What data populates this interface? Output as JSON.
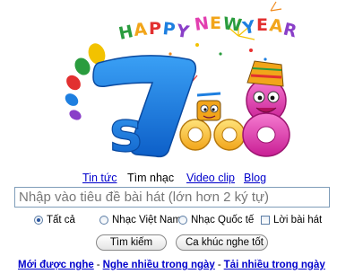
{
  "logo": {
    "banner_text": "HAPPY NEW YEAR",
    "brand_text": "7s008"
  },
  "tabs": [
    {
      "label": "Tin tức"
    },
    {
      "label": "Tìm nhạc"
    },
    {
      "label": "Video clip"
    },
    {
      "label": "Blog"
    }
  ],
  "search": {
    "placeholder": "Nhập vào tiêu đề bài hát (lớn hơn 2 ký tự)",
    "value": ""
  },
  "options": {
    "all": "Tất cả",
    "vietnam": "Nhạc Việt Nam",
    "international": "Nhạc Quốc tế",
    "lyrics": "Lời bài hát",
    "selected": "all"
  },
  "buttons": {
    "search": "Tìm kiếm",
    "top_songs": "Ca khúc nghe tốt"
  },
  "bottom_links": [
    {
      "label": "Mới được nghe"
    },
    {
      "label": "Nghe nhiều trong ngày"
    },
    {
      "label": "Tải nhiều trong ngày"
    }
  ],
  "colors": {
    "link": "#0000cc",
    "logo_blue": "#1e7fe0",
    "logo_pink": "#e23fb0"
  }
}
